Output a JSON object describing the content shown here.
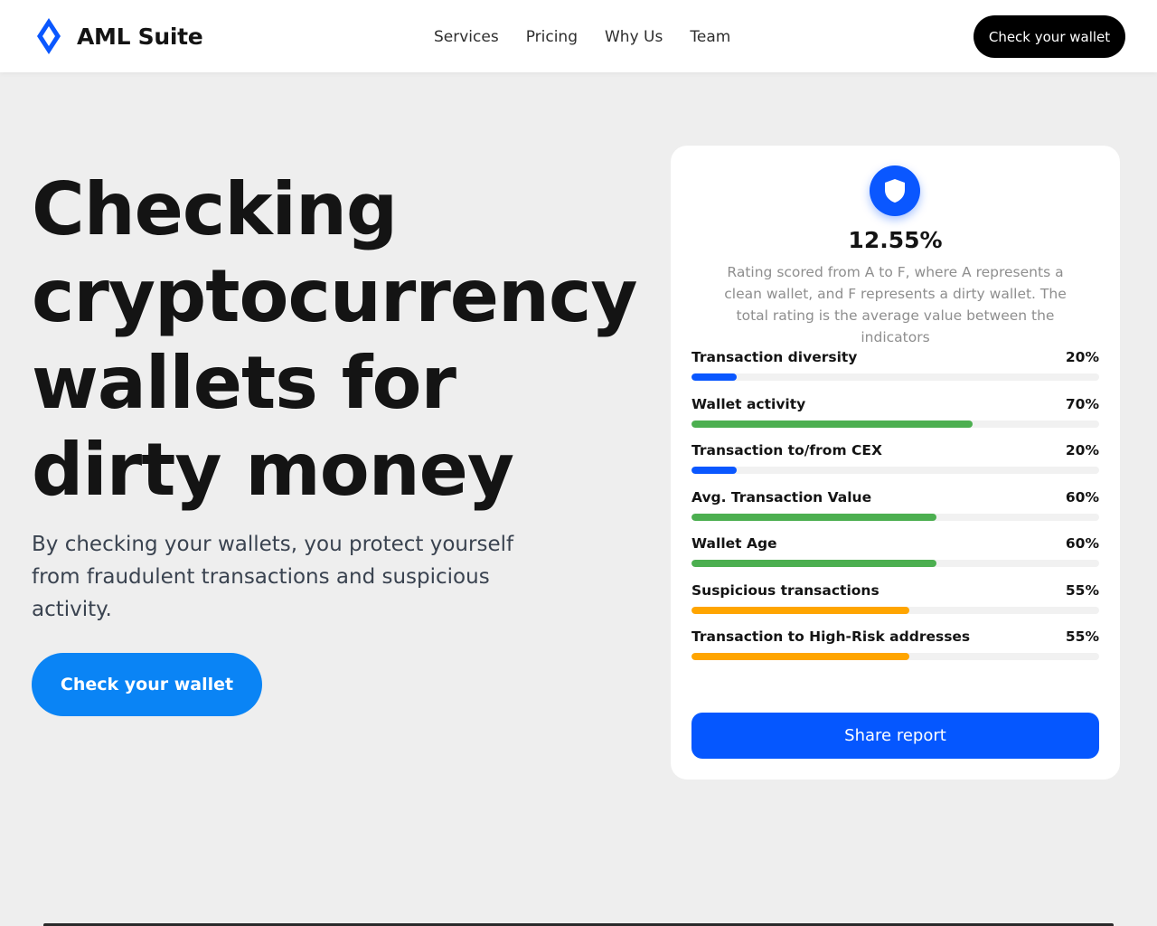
{
  "brand": {
    "name": "AML Suite",
    "accent": "#0a57ff"
  },
  "nav": {
    "links": [
      "Services",
      "Pricing",
      "Why Us",
      "Team"
    ],
    "cta_label": "Check your wallet"
  },
  "hero": {
    "title": "Checking cryptocurrency wallets for dirty money",
    "subtitle": "By checking your wallets, you protect yourself from fraudulent transactions and suspicious activity.",
    "cta_label": "Check your wallet"
  },
  "report": {
    "icon": "shield-icon",
    "score": "12.55%",
    "description": "Rating scored from A to F, where A represents a clean wallet, and F represents a dirty wallet. The total rating is the average value between the indicators",
    "metrics": [
      {
        "label": "Transaction diversity",
        "value": "20%",
        "fraction": 0.11,
        "color": "#0a57ff"
      },
      {
        "label": "Wallet activity",
        "value": "70%",
        "fraction": 0.69,
        "color": "#4caf50"
      },
      {
        "label": "Transaction to/from CEX",
        "value": "20%",
        "fraction": 0.11,
        "color": "#0a57ff"
      },
      {
        "label": "Avg. Transaction Value",
        "value": "60%",
        "fraction": 0.6,
        "color": "#4caf50"
      },
      {
        "label": "Wallet Age",
        "value": "60%",
        "fraction": 0.6,
        "color": "#4caf50"
      },
      {
        "label": "Suspicious transactions",
        "value": "55%",
        "fraction": 0.535,
        "color": "#ffa500"
      },
      {
        "label": "Transaction to High-Risk addresses",
        "value": "55%",
        "fraction": 0.535,
        "color": "#ffa500"
      }
    ],
    "share_label": "Share report"
  }
}
